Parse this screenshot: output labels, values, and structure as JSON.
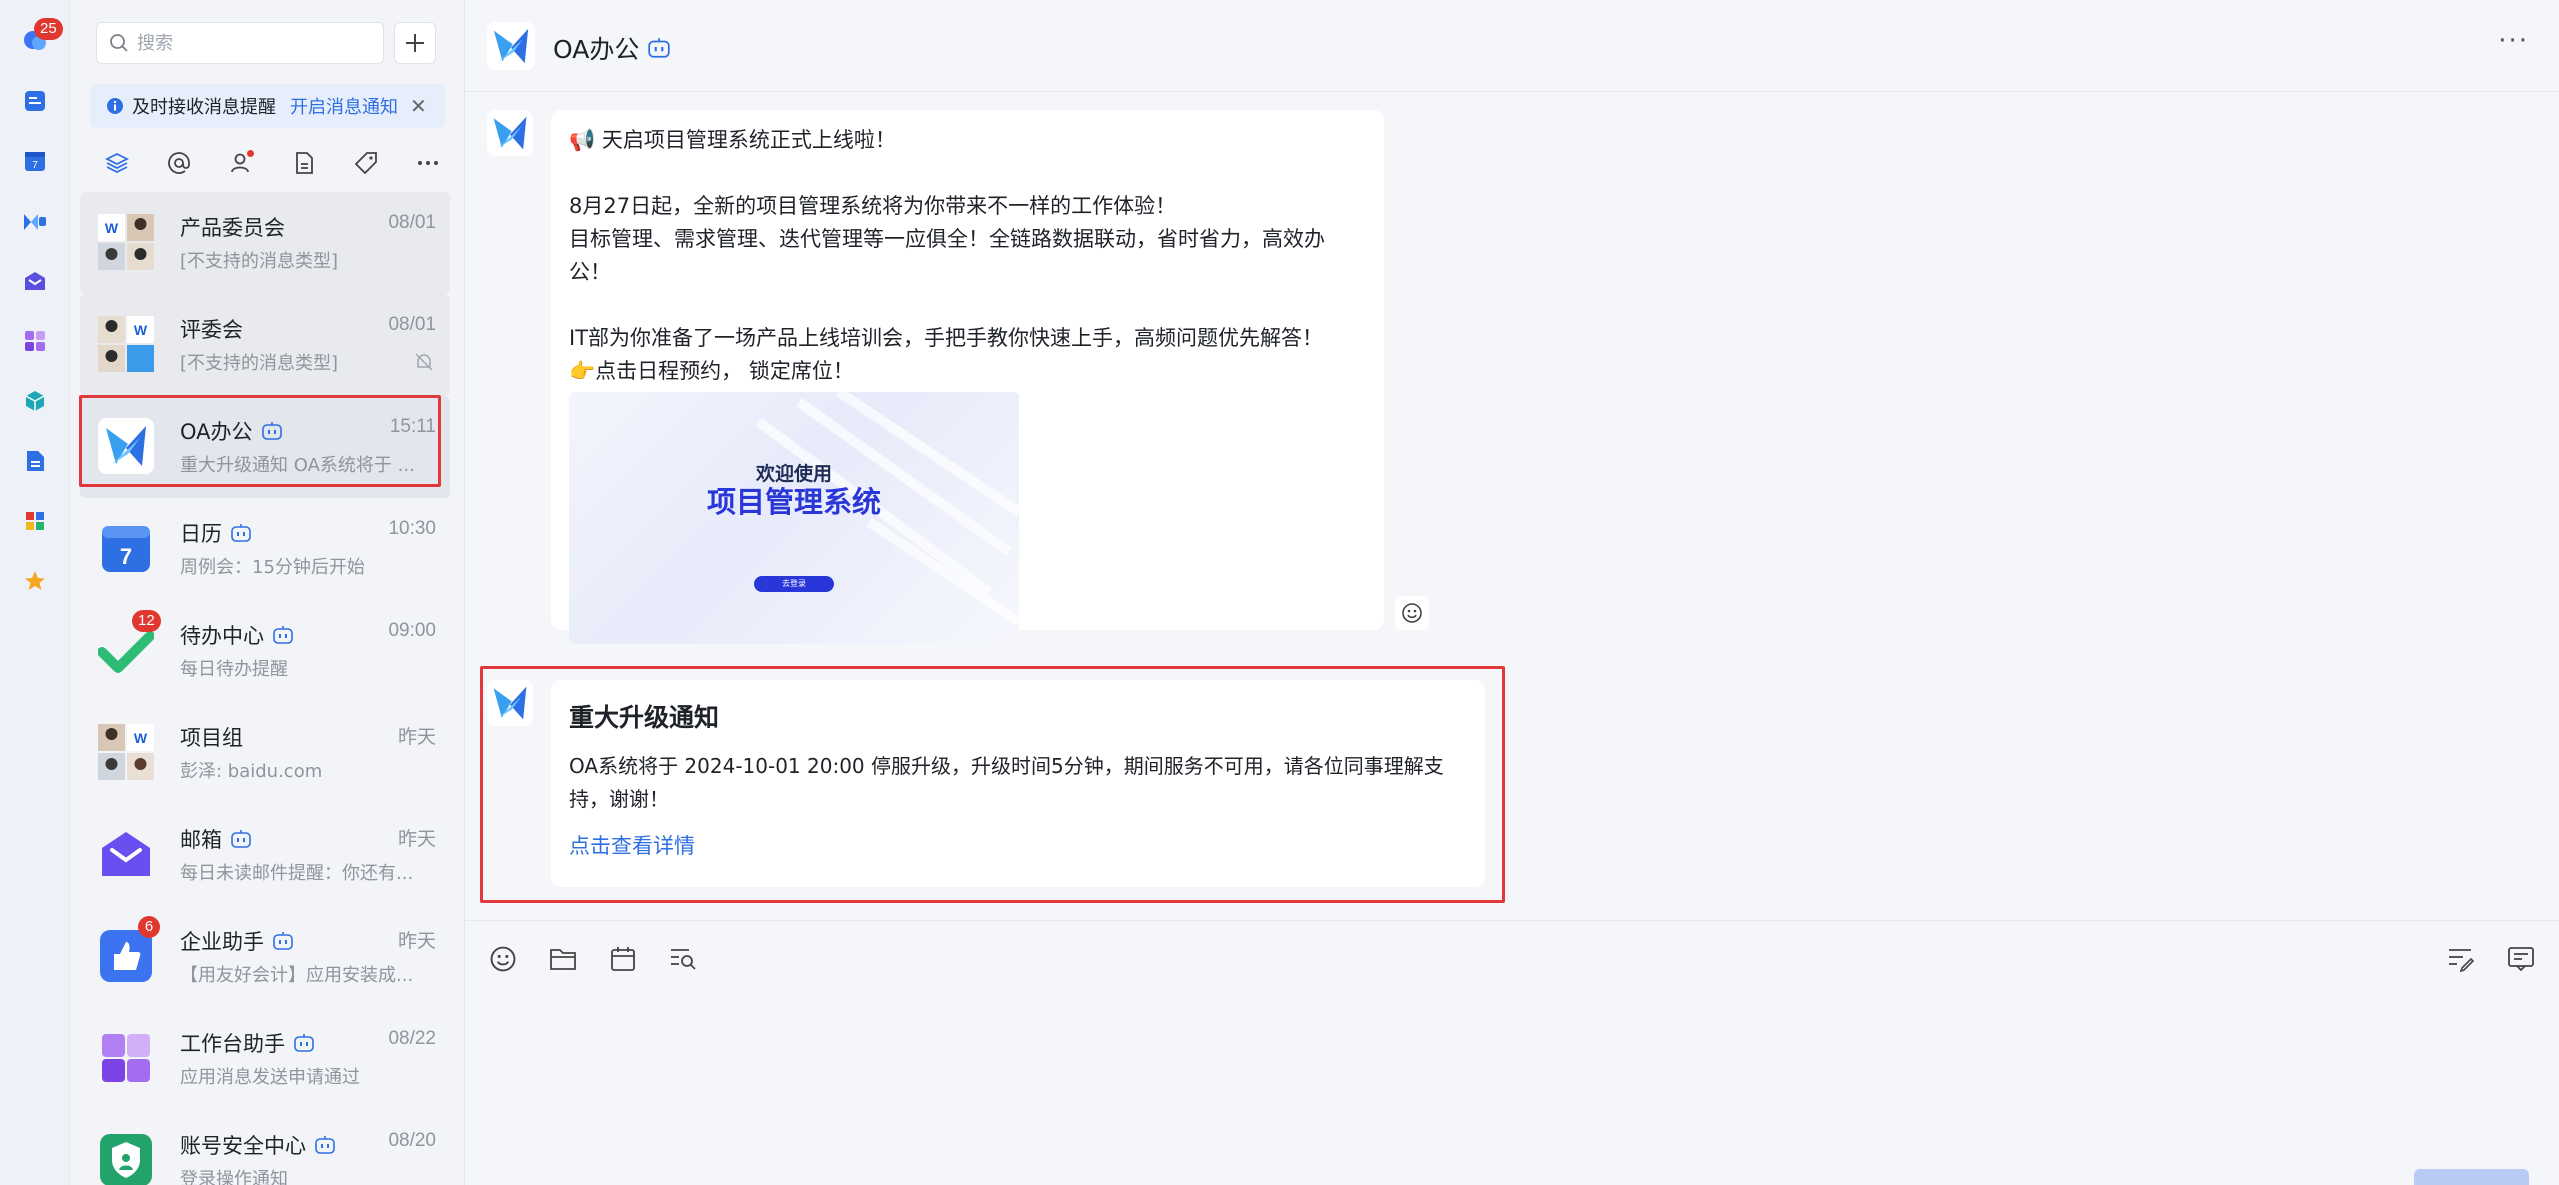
{
  "rail": {
    "chat_badge": "25"
  },
  "search": {
    "placeholder": "搜索"
  },
  "notice": {
    "text": "及时接收消息提醒",
    "link": "开启消息通知"
  },
  "sessions": [
    {
      "name": "产品委员会",
      "time": "08/01",
      "preview": "[不支持的消息类型]",
      "bot": false
    },
    {
      "name": "评委会",
      "time": "08/01",
      "preview": "[不支持的消息类型]",
      "bot": false,
      "muted": true
    },
    {
      "name": "OA办公",
      "time": "15:11",
      "preview": "重大升级通知 OA系统将于 ...",
      "bot": true,
      "selected": true
    },
    {
      "name": "日历",
      "time": "10:30",
      "preview": "周例会：15分钟后开始",
      "bot": true
    },
    {
      "name": "待办中心",
      "time": "09:00",
      "preview": "每日待办提醒",
      "bot": true,
      "badge": "12"
    },
    {
      "name": "项目组",
      "time": "昨天",
      "preview": "彭泽: baidu.com",
      "bot": false
    },
    {
      "name": "邮箱",
      "time": "昨天",
      "preview": "每日未读邮件提醒：你还有...",
      "bot": true
    },
    {
      "name": "企业助手",
      "time": "昨天",
      "preview": "【用友好会计】应用安装成...",
      "bot": true,
      "badge": "6"
    },
    {
      "name": "工作台助手",
      "time": "08/22",
      "preview": "应用消息发送申请通过",
      "bot": true
    },
    {
      "name": "账号安全中心",
      "time": "08/20",
      "preview": "登录操作通知",
      "bot": true
    }
  ],
  "chat": {
    "title": "OA办公",
    "message1": {
      "lines": [
        "📢 天启项目管理系统正式上线啦！",
        "",
        "8月27日起，全新的项目管理系统将为你带来不一样的工作体验！",
        "目标管理、需求管理、迭代管理等一应俱全！全链路数据联动，省时省力，高效办公！",
        "",
        "IT部为你准备了一场产品上线培训会，手把手教你快速上手，高频问题优先解答！",
        "👉点击日程预约， 锁定席位！"
      ],
      "banner_sub": "欢迎使用",
      "banner_title": "项目管理系统",
      "banner_button": "去登录"
    },
    "message2": {
      "title": "重大升级通知",
      "content": "OA系统将于 2024-10-01 20:00 停服升级，升级时间5分钟，期间服务不可用，请各位同事理解支持，谢谢！",
      "link": "点击查看详情"
    }
  },
  "colors": {
    "accent": "#2f6fe4",
    "highlight": "#e0383b",
    "badge": "#e0382f"
  }
}
